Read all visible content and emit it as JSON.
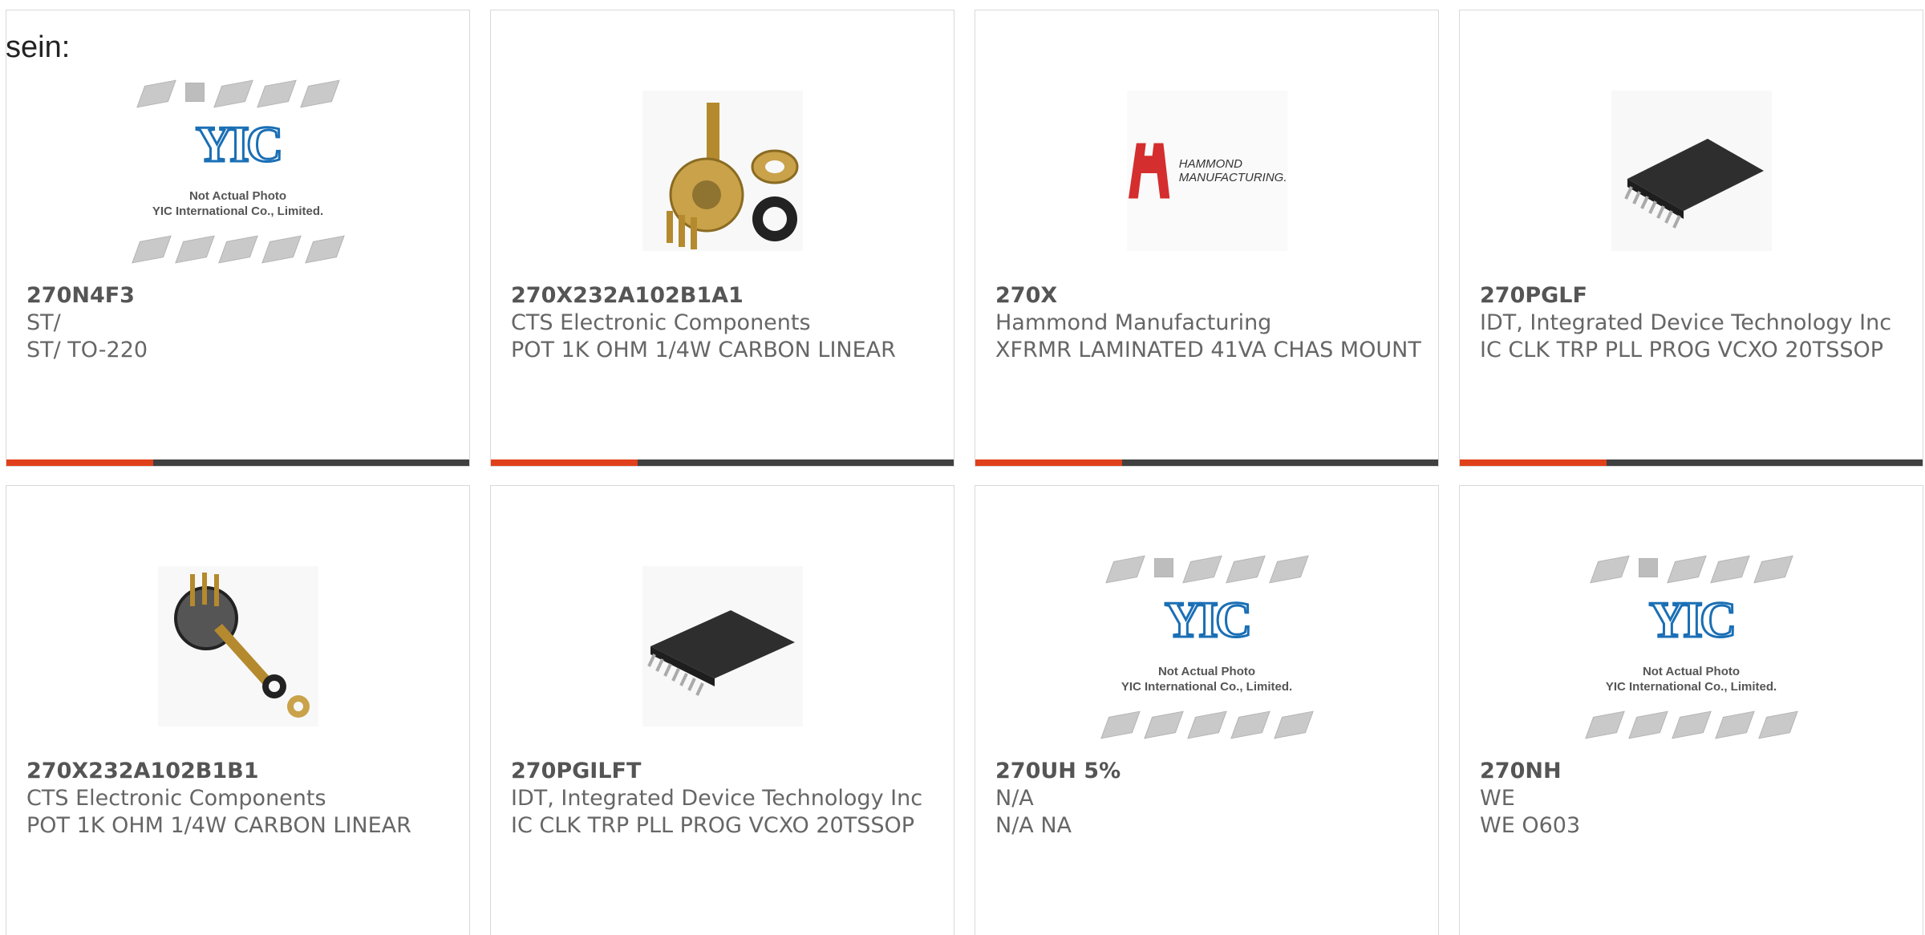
{
  "prefix_text": "sein:",
  "image_caption": {
    "line1": "Not Actual Photo",
    "line2": "YIC International Co., Limited."
  },
  "brand_logo": {
    "mark": "YIC",
    "hammond_line1": "HAMMOND",
    "hammond_line2": "MANUFACTURING."
  },
  "colors": {
    "accent_bar": "#e0401a",
    "dark_bar": "#404040",
    "hammond_red": "#d42e2e",
    "yic_blue": "#1a6fb5"
  },
  "products": [
    {
      "part": "270N4F3",
      "mfr": "ST/",
      "desc": "ST/ TO-220",
      "image": "yic-placeholder"
    },
    {
      "part": "270X232A102B1A1",
      "mfr": "CTS Electronic Components",
      "desc": "POT 1K OHM 1/4W CARBON LINEAR",
      "image": "potentiometer-photo"
    },
    {
      "part": "270X",
      "mfr": "Hammond Manufacturing",
      "desc": "XFRMR LAMINATED 41VA CHAS MOUNT",
      "image": "hammond-logo"
    },
    {
      "part": "270PGLF",
      "mfr": "IDT, Integrated Device Technology Inc",
      "desc": "IC CLK TRP PLL PROG VCXO 20TSSOP",
      "image": "tssop-chip-photo"
    },
    {
      "part": "270X232A102B1B1",
      "mfr": "CTS Electronic Components",
      "desc": "POT 1K OHM 1/4W CARBON LINEAR",
      "image": "potentiometer-photo"
    },
    {
      "part": "270PGILFT",
      "mfr": "IDT, Integrated Device Technology Inc",
      "desc": "IC CLK TRP PLL PROG VCXO 20TSSOP",
      "image": "tssop-chip-photo"
    },
    {
      "part": "270UH 5%",
      "mfr": "N/A",
      "desc": "N/A NA",
      "image": "yic-placeholder"
    },
    {
      "part": "270NH",
      "mfr": "WE",
      "desc": "WE O603",
      "image": "yic-placeholder"
    }
  ]
}
